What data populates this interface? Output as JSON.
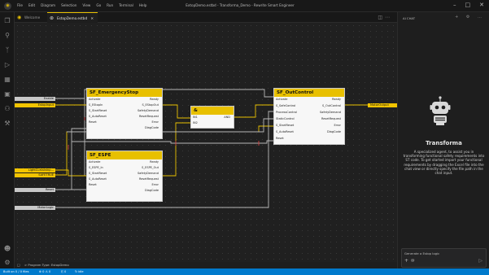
{
  "app": {
    "menu": [
      "File",
      "Edit",
      "Diagram",
      "Selection",
      "View",
      "Go",
      "Run",
      "Terminal",
      "Help"
    ],
    "window_title": "ExtopDemo.estbd - Transforma_Demo - Rewrite Smart Engineer",
    "window_controls": [
      "–",
      "□",
      "✕"
    ]
  },
  "tabs": [
    {
      "label": "Welcome",
      "icon": "welcome-icon"
    },
    {
      "label": "EstopDemo.estbd",
      "icon": "diagram-icon",
      "close": "✕"
    }
  ],
  "diagram": {
    "accent_color": "#e8c000",
    "blocks": {
      "estop": {
        "title": "SF_EmergencyStop",
        "inputs": [
          "Activate",
          "S_EStopIn",
          "S_StartReset",
          "S_AutoReset",
          "Reset"
        ],
        "outputs": [
          "Ready",
          "S_EStopOut",
          "SafetyDemand",
          "ResetRequest",
          "Error",
          "DiagCode"
        ]
      },
      "and": {
        "title": "&",
        "inputs": [
          "IN1",
          "IN2"
        ],
        "outputs": [
          "AND"
        ]
      },
      "espe": {
        "title": "SF_ESPE",
        "inputs": [
          "Activate",
          "S_ESPE_In",
          "S_StartReset",
          "S_AutoReset",
          "Reset"
        ],
        "outputs": [
          "Ready",
          "S_ESPE_Out",
          "SafetyDemand",
          "ResetRequest",
          "Error",
          "DiagCode"
        ]
      },
      "outcontrol": {
        "title": "SF_OutControl",
        "inputs": [
          "Activate",
          "S_SafeControl",
          "ProcessControl",
          "StaticControl",
          "S_StartReset",
          "S_AutoReset",
          "Reset"
        ],
        "outputs": [
          "Ready",
          "S_OutControl",
          "SafetyDemand",
          "ResetRequest",
          "Error",
          "DiagCode"
        ]
      }
    },
    "variables": {
      "enable": "Enable",
      "estop_input": "EstopInput",
      "light_curtain": "LightCurtainInp...",
      "safetrue": "SAFETRUE",
      "reset": "Reset",
      "motor_logic": "MotorLogic",
      "motor_output": "MotorOutput"
    }
  },
  "panel": {
    "title": "AI CHAT",
    "actions": "+ ⚙ …",
    "agent_name": "Transforma",
    "agent_desc": "A specialized agent, to assist you in transforming functional safety requirements into ST code. To get started import your functional requirements by dragging the Excel file into the chat view or directly specify the file path in the chat input.",
    "chat_placeholder": "Generate a Estop logic",
    "chat_plus": "+",
    "chat_at": "@",
    "chat_send": "▷"
  },
  "bottom_bar": {
    "panel_icon": "□",
    "breadcrumb": "> Program Type: EstopDemo"
  },
  "statusbar": {
    "left": "Built on 0 / 0 files",
    "problems": "⊗ 0 ⚠ 0",
    "ports": "⎘ 0",
    "sync": "↻ idle"
  }
}
